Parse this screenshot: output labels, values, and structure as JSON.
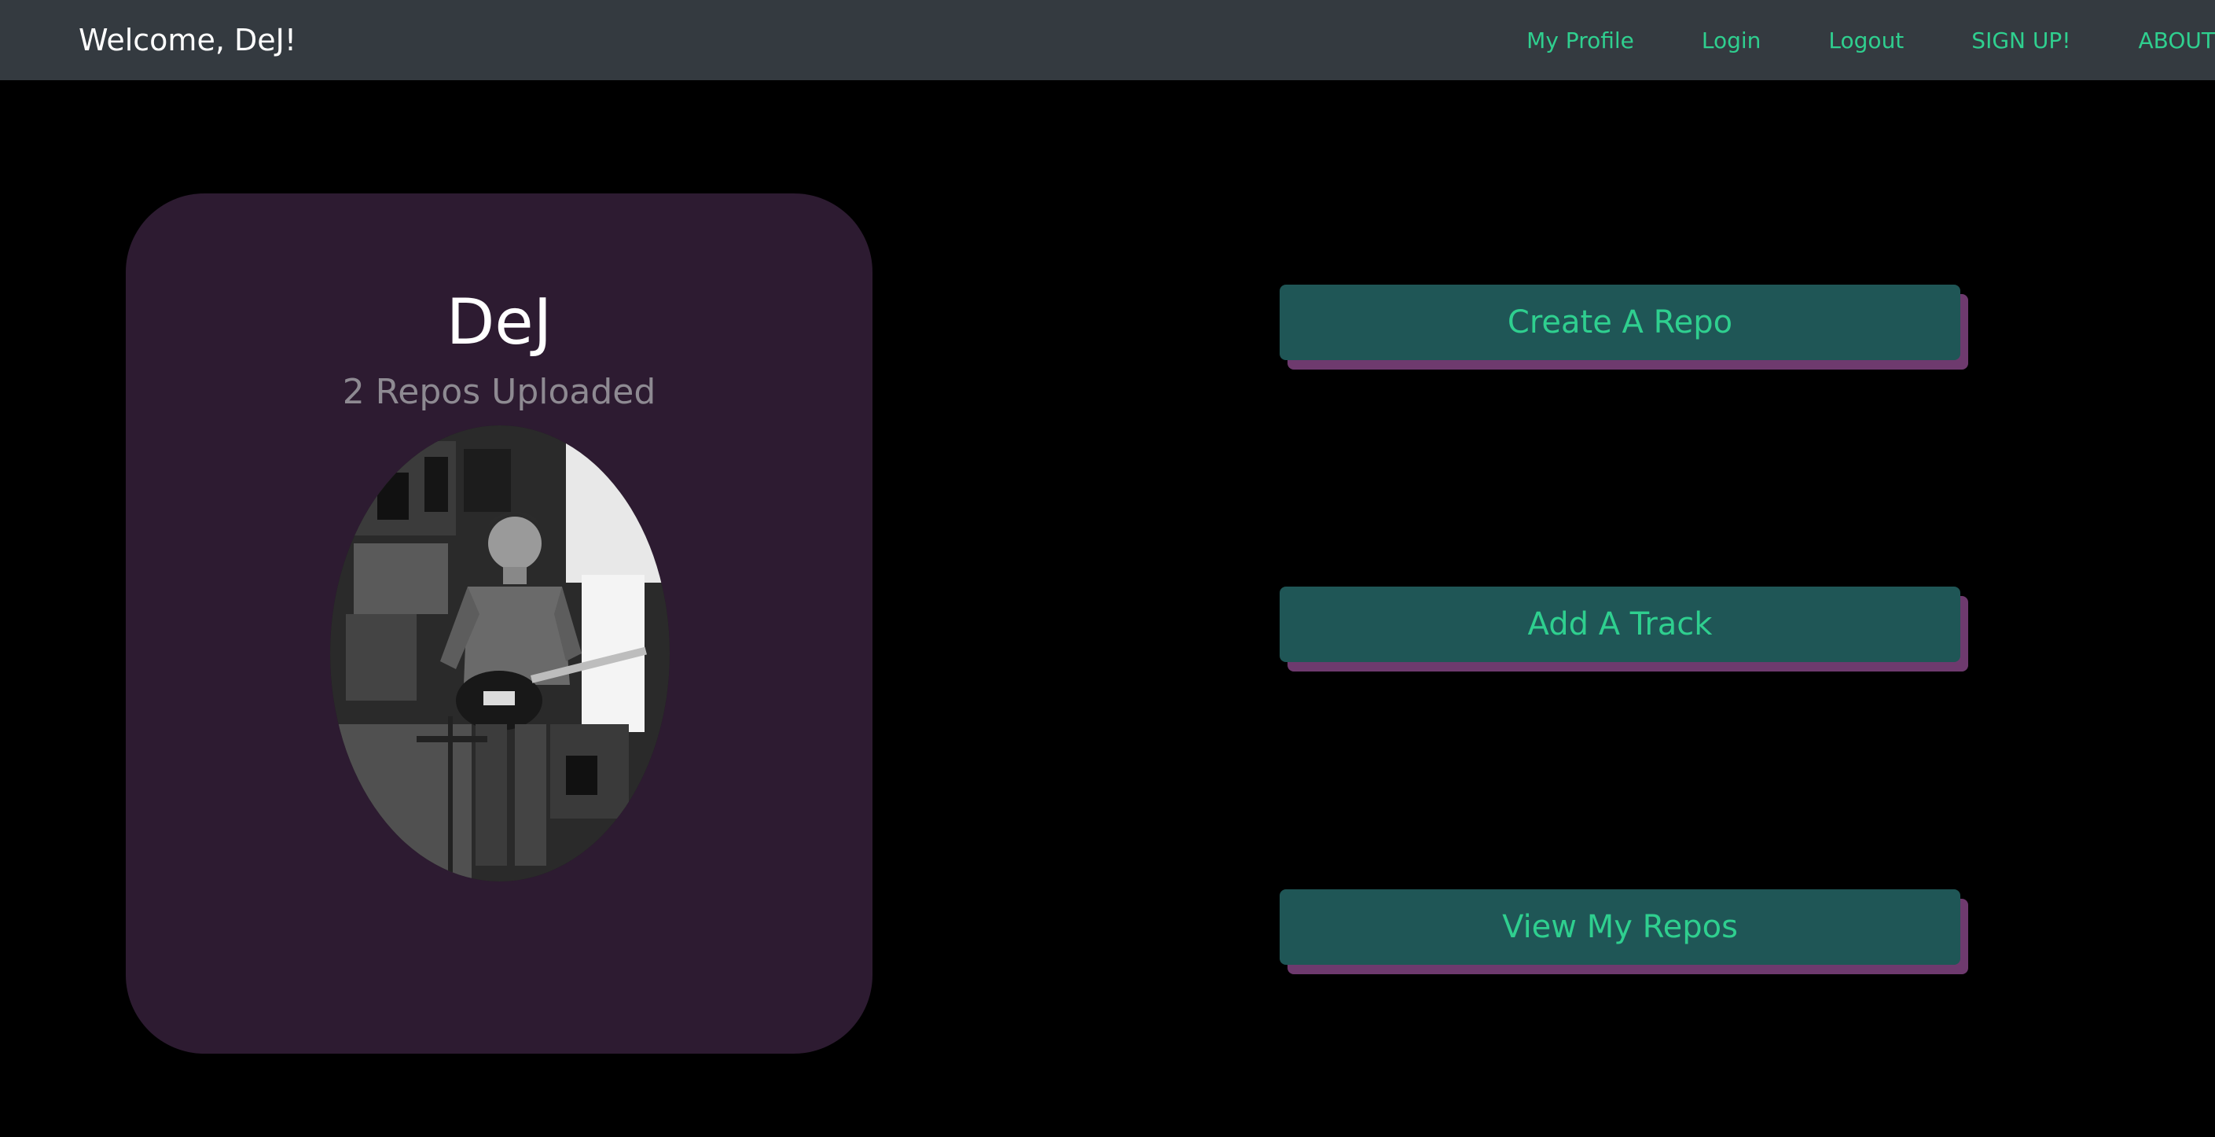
{
  "navbar": {
    "brand": "Welcome, DeJ!",
    "links": [
      {
        "label": "My Profile"
      },
      {
        "label": "Login"
      },
      {
        "label": "Logout"
      },
      {
        "label": "SIGN UP!"
      },
      {
        "label": "ABOUT"
      }
    ]
  },
  "profile": {
    "name": "DeJ",
    "repos_uploaded": "2 Repos Uploaded"
  },
  "actions": {
    "create_repo": "Create A Repo",
    "add_track": "Add A Track",
    "view_repos": "View My Repos"
  },
  "colors": {
    "navbar_bg": "#343a40",
    "page_bg": "#000000",
    "accent": "#2fcf8f",
    "card_bg": "#2d1b31",
    "button_bg": "#1f5656",
    "button_shadow": "#6e3a6e"
  }
}
